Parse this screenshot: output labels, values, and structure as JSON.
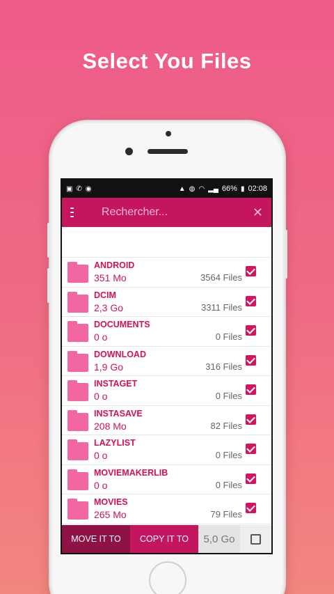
{
  "headline": "Select You Files",
  "status_bar": {
    "left_icons": [
      "image-icon",
      "phone-icon",
      "sync-icon"
    ],
    "right_icons": [
      "lock-icon",
      "alarm-icon",
      "wifi-icon",
      "signal-icon",
      "battery-icon"
    ],
    "battery": "66%",
    "time": "02:08"
  },
  "appbar": {
    "search_placeholder": "Rechercher...",
    "close_glyph": "✕",
    "color": "#c4165f"
  },
  "folders": [
    {
      "name": "ANDROID",
      "size": "351 Mo",
      "count": "3564 Files",
      "checked": true
    },
    {
      "name": "DCIM",
      "size": "2,3 Go",
      "count": "3311 Files",
      "checked": true
    },
    {
      "name": "DOCUMENTS",
      "size": "0 o",
      "count": "0 Files",
      "checked": true
    },
    {
      "name": "DOWNLOAD",
      "size": "1,9 Go",
      "count": "316 Files",
      "checked": true
    },
    {
      "name": "INSTAGET",
      "size": "0 o",
      "count": "0 Files",
      "checked": true
    },
    {
      "name": "INSTASAVE",
      "size": "208 Mo",
      "count": "82 Files",
      "checked": true
    },
    {
      "name": "LAZYLIST",
      "size": "0 o",
      "count": "0 Files",
      "checked": true
    },
    {
      "name": "MOVIEMAKERLIB",
      "size": "0 o",
      "count": "0 Files",
      "checked": true
    },
    {
      "name": "MOVIES",
      "size": "265 Mo",
      "count": "79 Files",
      "checked": true
    }
  ],
  "bottom": {
    "move_label": "MOVE IT TO",
    "copy_label": "COPY IT TO",
    "total": "5,0 Go",
    "select_all_checked": false
  },
  "colors": {
    "accent": "#c4165f",
    "dark_accent": "#8e1244",
    "folder": "#f266a2",
    "text_red": "#d4134d"
  }
}
